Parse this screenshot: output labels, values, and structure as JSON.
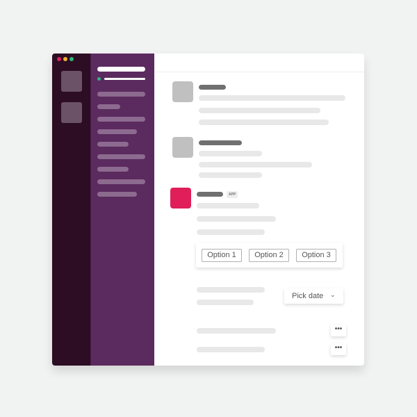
{
  "window": {
    "controls": [
      {
        "name": "close",
        "color": "#e01e5a"
      },
      {
        "name": "minimize",
        "color": "#ecb22e"
      },
      {
        "name": "maximize",
        "color": "#2eb67d"
      }
    ]
  },
  "colors": {
    "rail": "#2c0d23",
    "sidebar": "#5b2a5e",
    "app_avatar": "#e01e5a",
    "status": "#2eb67d"
  },
  "messages": [
    {
      "badge": ""
    },
    {
      "badge": ""
    },
    {
      "badge": "APP"
    }
  ],
  "actions": {
    "options": [
      "Option 1",
      "Option 2",
      "Option 3"
    ],
    "pick_date": "Pick date",
    "dropdown_icon": "chevron-down-icon",
    "more": "•••"
  }
}
